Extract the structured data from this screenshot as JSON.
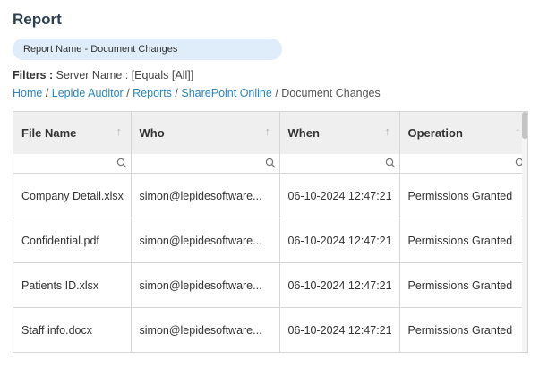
{
  "page": {
    "title": "Report",
    "report_name": "Report Name - Document Changes"
  },
  "filters": {
    "label": "Filters :",
    "value": "Server Name : [Equals [All]]"
  },
  "breadcrumb": {
    "items": [
      "Home",
      "Lepide Auditor",
      "Reports",
      "SharePoint Online"
    ],
    "current": "Document Changes",
    "separator": "/"
  },
  "table": {
    "columns": [
      {
        "label": "File Name"
      },
      {
        "label": "Who"
      },
      {
        "label": "When"
      },
      {
        "label": "Operation"
      }
    ],
    "rows": [
      {
        "file": "Company Detail.xlsx",
        "who": "simon@lepidesoftware...",
        "when": "06-10-2024 12:47:21",
        "operation": "Permissions Granted"
      },
      {
        "file": "Confidential.pdf",
        "who": "simon@lepidesoftware...",
        "when": "06-10-2024 12:47:21",
        "operation": "Permissions Granted"
      },
      {
        "file": "Patients ID.xlsx",
        "who": "simon@lepidesoftware...",
        "when": "06-10-2024 12:47:21",
        "operation": "Permissions Granted"
      },
      {
        "file": "Staff info.docx",
        "who": "simon@lepidesoftware...",
        "when": "06-10-2024 12:47:21",
        "operation": "Permissions Granted"
      }
    ]
  },
  "icons": {
    "sort": "sort-arrow-up-icon",
    "filter": "search-icon"
  },
  "colors": {
    "title": "#2d3e50",
    "link": "#2a85c1",
    "pill_bg": "#dfecfa",
    "header_bg": "#efefef",
    "border": "#d6d6d6"
  }
}
